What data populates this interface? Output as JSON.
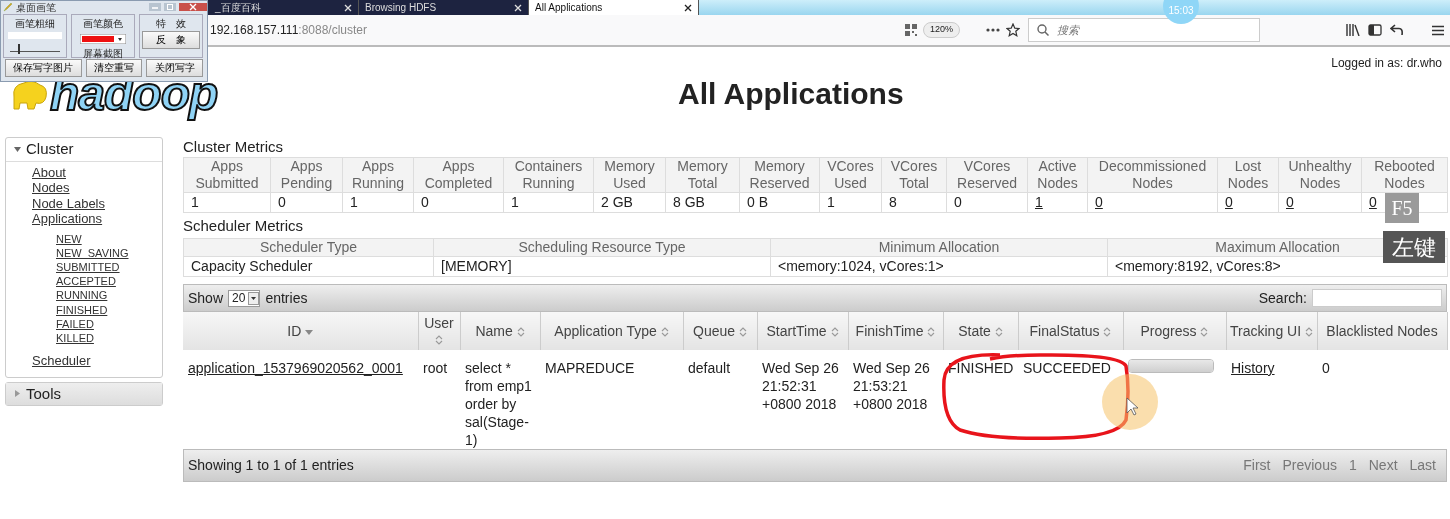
{
  "browser": {
    "tabs": [
      {
        "label": "_百度百科",
        "selected": false
      },
      {
        "label": "Browsing HDFS",
        "selected": false
      },
      {
        "label": "All Applications",
        "selected": true
      }
    ],
    "clock": "15:03",
    "url_host": "192.168.157.111",
    "url_path": ":8088/cluster",
    "zoom": "120%",
    "search": {
      "placeholder": "搜索"
    }
  },
  "pen_tool": {
    "title": "桌面画笔",
    "thickness_label": "画笔粗细",
    "thickness": {
      "level": 0.15
    },
    "color_label": "画笔颜色",
    "screenshot_label": "屏幕截图",
    "effect_label": "特　效",
    "effect_button": "反　象",
    "buttons": [
      "保存写字图片",
      "清空重写",
      "关闭写字"
    ]
  },
  "header": {
    "logged_in": "Logged in as: dr.who",
    "logo": "hadoop",
    "title": "All Applications"
  },
  "sidebar": [
    {
      "label": "Cluster",
      "expanded": true,
      "children": [
        {
          "label": "About"
        },
        {
          "label": "Nodes"
        },
        {
          "label": "Node Labels"
        },
        {
          "label": "Applications",
          "children": [
            {
              "label": "NEW"
            },
            {
              "label": "NEW_SAVING"
            },
            {
              "label": "SUBMITTED"
            },
            {
              "label": "ACCEPTED"
            },
            {
              "label": "RUNNING"
            },
            {
              "label": "FINISHED"
            },
            {
              "label": "FAILED"
            },
            {
              "label": "KILLED"
            }
          ]
        },
        {
          "label": "Scheduler"
        }
      ]
    },
    {
      "label": "Tools",
      "expanded": false
    }
  ],
  "cluster_metrics": {
    "title": "Cluster Metrics",
    "columns": [
      "Apps Submitted",
      "Apps Pending",
      "Apps Running",
      "Apps Completed",
      "Containers Running",
      "Memory Used",
      "Memory Total",
      "Memory Reserved",
      "VCores Used",
      "VCores Total",
      "VCores Reserved",
      "Active Nodes",
      "Decommissioned Nodes",
      "Lost Nodes",
      "Unhealthy Nodes",
      "Rebooted Nodes"
    ],
    "values": [
      {
        "text": "1",
        "link": false
      },
      {
        "text": "0",
        "link": false
      },
      {
        "text": "1",
        "link": false
      },
      {
        "text": "0",
        "link": false
      },
      {
        "text": "1",
        "link": false
      },
      {
        "text": "2 GB",
        "link": false
      },
      {
        "text": "8 GB",
        "link": false
      },
      {
        "text": "0 B",
        "link": false
      },
      {
        "text": "1",
        "link": false
      },
      {
        "text": "8",
        "link": false
      },
      {
        "text": "0",
        "link": false
      },
      {
        "text": "1",
        "link": true
      },
      {
        "text": "0",
        "link": true
      },
      {
        "text": "0",
        "link": true
      },
      {
        "text": "0",
        "link": true
      },
      {
        "text": "0",
        "link": true
      }
    ]
  },
  "scheduler_metrics": {
    "title": "Scheduler Metrics",
    "columns": [
      "Scheduler Type",
      "Scheduling Resource Type",
      "Minimum Allocation",
      "Maximum Allocation"
    ],
    "rows": [
      [
        "Capacity Scheduler",
        "[MEMORY]",
        "<memory:1024, vCores:1>",
        "<memory:8192, vCores:8>"
      ]
    ]
  },
  "applications": {
    "show_label": "Show",
    "page_size": "20",
    "entries_label": "entries",
    "search_label": "Search:",
    "columns": [
      {
        "label": "ID",
        "sortable": true,
        "sorted": true
      },
      {
        "label": "User",
        "sortable": true,
        "sorted": false
      },
      {
        "label": "Name",
        "sortable": true,
        "sorted": false
      },
      {
        "label": "Application Type",
        "sortable": true,
        "sorted": false
      },
      {
        "label": "Queue",
        "sortable": true,
        "sorted": false
      },
      {
        "label": "StartTime",
        "sortable": true,
        "sorted": false
      },
      {
        "label": "FinishTime",
        "sortable": true,
        "sorted": false
      },
      {
        "label": "State",
        "sortable": true,
        "sorted": false
      },
      {
        "label": "FinalStatus",
        "sortable": true,
        "sorted": false
      },
      {
        "label": "Progress",
        "sortable": true,
        "sorted": false
      },
      {
        "label": "Tracking UI",
        "sortable": true,
        "sorted": false
      },
      {
        "label": "Blacklisted Nodes",
        "sortable": false,
        "sorted": false
      }
    ],
    "rows": [
      {
        "id": "application_1537969020562_0001",
        "user": "root",
        "name": "select * from emp1 order by sal(Stage-1)",
        "type": "MAPREDUCE",
        "queue": "default",
        "start": "Wed Sep 26 21:52:31 +0800 2018",
        "finish": "Wed Sep 26 21:53:21 +0800 2018",
        "state": "FINISHED",
        "final_status": "SUCCEEDED",
        "progress": {
          "level": 1
        },
        "tracking": "History",
        "blacklisted": "0"
      }
    ],
    "info": "Showing 1 to 1 of 1 entries",
    "pager": [
      {
        "label": "First",
        "disabled": true
      },
      {
        "label": "Previous",
        "disabled": true
      },
      {
        "label": "1",
        "disabled": true
      },
      {
        "label": "Next",
        "disabled": true
      },
      {
        "label": "Last",
        "disabled": true
      }
    ]
  },
  "overlays": {
    "key": "F5",
    "mouse": "左键"
  }
}
